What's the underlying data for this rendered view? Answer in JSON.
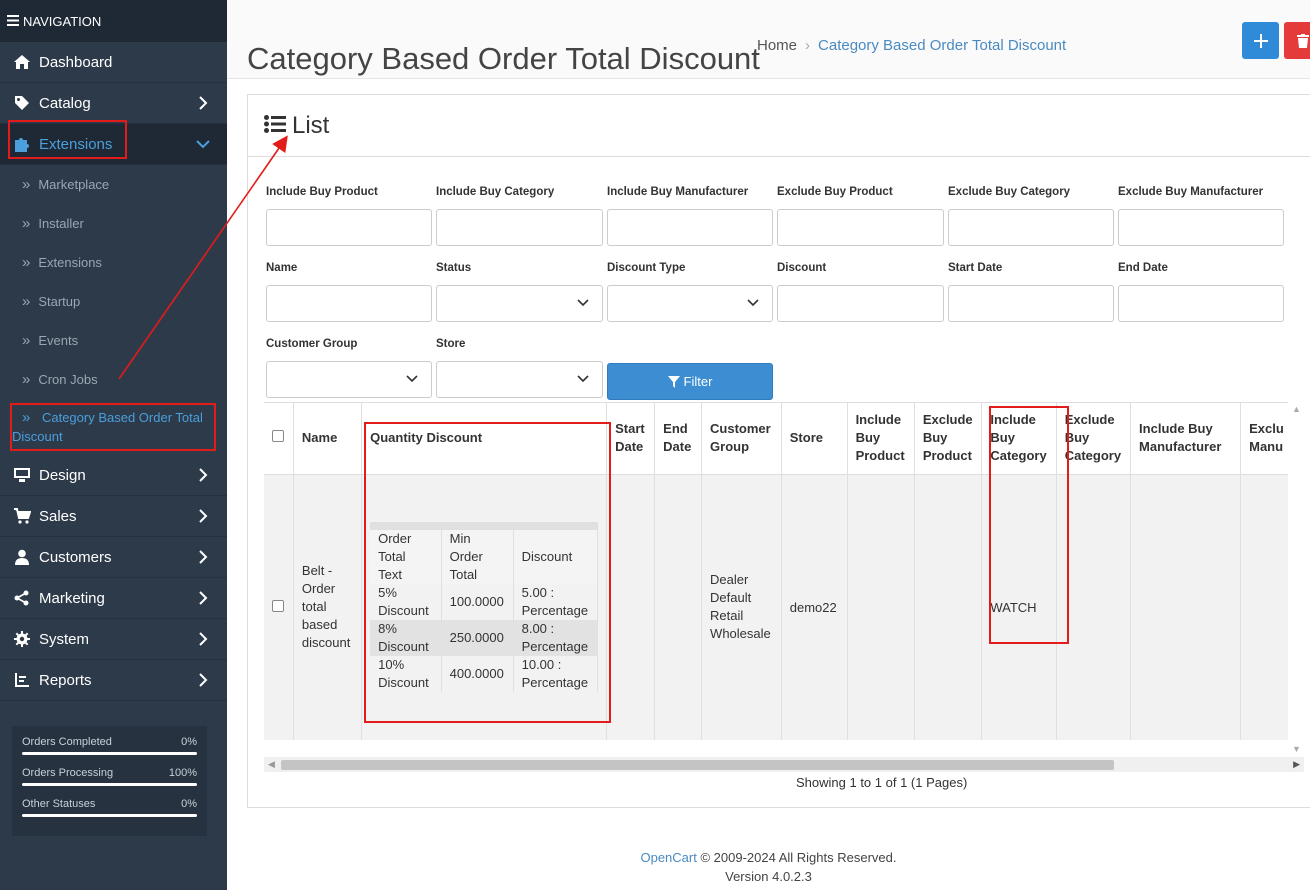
{
  "nav": {
    "header": "NAVIGATION",
    "items": [
      {
        "label": "Dashboard"
      },
      {
        "label": "Catalog"
      },
      {
        "label": "Extensions"
      },
      {
        "label": "Design"
      },
      {
        "label": "Sales"
      },
      {
        "label": "Customers"
      },
      {
        "label": "Marketing"
      },
      {
        "label": "System"
      },
      {
        "label": "Reports"
      }
    ],
    "extensions_sub": [
      {
        "label": "Marketplace"
      },
      {
        "label": "Installer"
      },
      {
        "label": "Extensions"
      },
      {
        "label": "Startup"
      },
      {
        "label": "Events"
      },
      {
        "label": "Cron Jobs"
      },
      {
        "label": "Category Based Order Total Discount"
      }
    ],
    "stats": [
      {
        "label": "Orders Completed",
        "value": "0%"
      },
      {
        "label": "Orders Processing",
        "value": "100%"
      },
      {
        "label": "Other Statuses",
        "value": "0%"
      }
    ]
  },
  "page": {
    "title": "Category Based Order Total Discount",
    "breadcrumb_home": "Home",
    "breadcrumb_current": "Category Based Order Total Discount",
    "panel_title": "List"
  },
  "filters": {
    "include_buy_product": "Include Buy Product",
    "include_buy_category": "Include Buy Category",
    "include_buy_manufacturer": "Include Buy Manufacturer",
    "exclude_buy_product": "Exclude Buy Product",
    "exclude_buy_category": "Exclude Buy Category",
    "exclude_buy_manufacturer": "Exclude Buy Manufacturer",
    "name": "Name",
    "status": "Status",
    "discount_type": "Discount Type",
    "discount": "Discount",
    "start_date": "Start Date",
    "end_date": "End Date",
    "customer_group": "Customer Group",
    "store": "Store",
    "filter_button": "Filter"
  },
  "table": {
    "headers": {
      "name": "Name",
      "quantity_discount": "Quantity Discount",
      "start_date": "Start Date",
      "end_date": "End Date",
      "customer_group": "Customer Group",
      "store": "Store",
      "include_buy_product": "Include Buy Product",
      "exclude_buy_product": "Exclude Buy Product",
      "include_buy_category": "Include Buy Category",
      "exclude_buy_category": "Exclude Buy Category",
      "include_buy_manufacturer": "Include Buy Manufacturer",
      "exclude_buy_manufacturer": "Exclu Manu"
    },
    "row": {
      "name": "Belt - Order total based discount",
      "customer_group": "Dealer Default Retail Wholesale",
      "store": "demo22",
      "include_buy_category": "WATCH"
    },
    "qd_headers": {
      "text": "Order Total Text",
      "min": "Min Order Total",
      "discount": "Discount"
    },
    "qd_rows": [
      {
        "text": "5% Discount",
        "min": "100.0000",
        "discount": "5.00 : Percentage"
      },
      {
        "text": "8% Discount",
        "min": "250.0000",
        "discount": "8.00 : Percentage"
      },
      {
        "text": "10% Discount",
        "min": "400.0000",
        "discount": "10.00 : Percentage"
      }
    ],
    "pager": "Showing 1 to 1 of 1 (1 Pages)"
  },
  "footer": {
    "brand": "OpenCart",
    "rights": " © 2009-2024 All Rights Reserved.",
    "version": "Version 4.0.2.3"
  },
  "colors": {
    "accent": "#4a9fdc",
    "sidebar": "#2d3a49",
    "annotation": "#e31b1b",
    "add": "#2f8ad8",
    "delete": "#e43a3a"
  }
}
